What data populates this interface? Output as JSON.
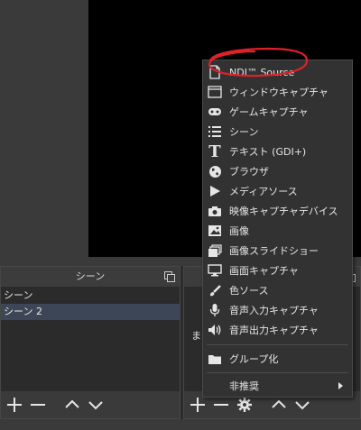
{
  "scenes_dock": {
    "title": "シーン",
    "items": [
      "シーン",
      "シーン 2"
    ],
    "selected_index": 1
  },
  "sources_dock": {
    "partial_text": "ま"
  },
  "add_source_menu": {
    "items": [
      {
        "label": "NDI™ Source",
        "icon": "file-icon"
      },
      {
        "label": "ウィンドウキャプチャ",
        "icon": "window-icon"
      },
      {
        "label": "ゲームキャプチャ",
        "icon": "gamepad-icon"
      },
      {
        "label": "シーン",
        "icon": "list-icon"
      },
      {
        "label": "テキスト (GDI+)",
        "icon": "text-icon"
      },
      {
        "label": "ブラウザ",
        "icon": "globe-icon"
      },
      {
        "label": "メディアソース",
        "icon": "play-icon"
      },
      {
        "label": "映像キャプチャデバイス",
        "icon": "camera-icon"
      },
      {
        "label": "画像",
        "icon": "image-icon"
      },
      {
        "label": "画像スライドショー",
        "icon": "slideshow-icon"
      },
      {
        "label": "画面キャプチャ",
        "icon": "monitor-icon"
      },
      {
        "label": "色ソース",
        "icon": "brush-icon"
      },
      {
        "label": "音声入力キャプチャ",
        "icon": "microphone-icon"
      },
      {
        "label": "音声出力キャプチャ",
        "icon": "speaker-icon"
      }
    ],
    "group_label": "グループ化",
    "deprecated_label": "非推奨"
  },
  "colors": {
    "annotation": "#e0202a",
    "menu_bg": "#323232",
    "preview_bg": "#000000",
    "selected_row": "#3d4656"
  }
}
